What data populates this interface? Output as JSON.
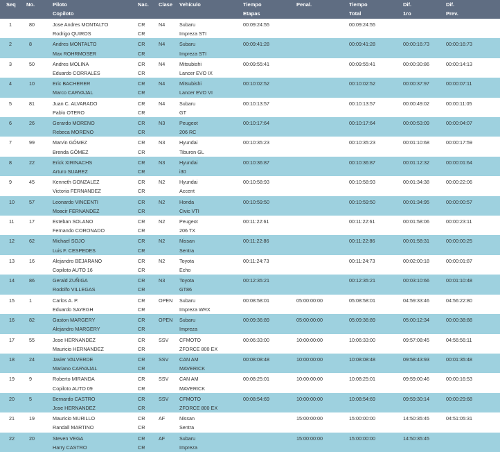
{
  "header": {
    "seq": "Seq",
    "no": "No.",
    "piloto": "Piloto",
    "copiloto": "Copiloto",
    "nac": "Nac.",
    "clase": "Clase",
    "vehiculo": "Vehículo",
    "tiempo_etapas_1": "Tiempo",
    "tiempo_etapas_2": "Etapas",
    "penal": "Penal.",
    "tiempo_total_1": "Tiempo",
    "tiempo_total_2": "Total",
    "dif1ro_1": "Dif.",
    "dif1ro_2": "1ro",
    "difprev_1": "Dif.",
    "difprev_2": "Prev."
  },
  "rows": [
    {
      "seq": "1",
      "no": "80",
      "piloto": "Jose Andres MONTALTO",
      "copiloto": "Rodrigo QUIROS",
      "nac1": "CR",
      "nac2": "CR",
      "clase": "N4",
      "marca": "Subaru",
      "modelo": "Impreza STI",
      "etapas": "00:09:24:55",
      "penal": "",
      "total": "00:09:24:55",
      "dif1ro": "",
      "difprev": ""
    },
    {
      "seq": "2",
      "no": "8",
      "piloto": "Andres MONTALTO",
      "copiloto": "Max ROHRMOSER",
      "nac1": "CR",
      "nac2": "CR",
      "clase": "N4",
      "marca": "Subaru",
      "modelo": "Impreza STI",
      "etapas": "00:09:41:28",
      "penal": "",
      "total": "00:09:41:28",
      "dif1ro": "00:00:16:73",
      "difprev": "00:00:16:73"
    },
    {
      "seq": "3",
      "no": "50",
      "piloto": "Andres MOLINA",
      "copiloto": "Eduardo CORRALES",
      "nac1": "CR",
      "nac2": "CR",
      "clase": "N4",
      "marca": "Mitsubishi",
      "modelo": "Lancer EVO IX",
      "etapas": "00:09:55:41",
      "penal": "",
      "total": "00:09:55:41",
      "dif1ro": "00:00:30:86",
      "difprev": "00:00:14:13"
    },
    {
      "seq": "4",
      "no": "10",
      "piloto": "Eric BACHERER",
      "copiloto": "Marco CARVAJAL",
      "nac1": "CR",
      "nac2": "CR",
      "clase": "N4",
      "marca": "Mitsubishi",
      "modelo": "Lancer EVO VI",
      "etapas": "00:10:02:52",
      "penal": "",
      "total": "00:10:02:52",
      "dif1ro": "00:00:37:97",
      "difprev": "00:00:07:11"
    },
    {
      "seq": "5",
      "no": "81",
      "piloto": "Juan C. ALVARADO",
      "copiloto": "Pablo OTERO",
      "nac1": "CR",
      "nac2": "CR",
      "clase": "N4",
      "marca": "Subaru",
      "modelo": "GT",
      "etapas": "00:10:13:57",
      "penal": "",
      "total": "00:10:13:57",
      "dif1ro": "00:00:49:02",
      "difprev": "00:00:11:05"
    },
    {
      "seq": "6",
      "no": "26",
      "piloto": "Gerardo MORENO",
      "copiloto": "Rebeca MORENO",
      "nac1": "CR",
      "nac2": "CR",
      "clase": "N3",
      "marca": "Peugeot",
      "modelo": "206 RC",
      "etapas": "00:10:17:64",
      "penal": "",
      "total": "00:10:17:64",
      "dif1ro": "00:00:53:09",
      "difprev": "00:00:04:07"
    },
    {
      "seq": "7",
      "no": "99",
      "piloto": "Marvin GÓMEZ",
      "copiloto": "Brenda GÓMEZ",
      "nac1": "CR",
      "nac2": "CR",
      "clase": "N3",
      "marca": "Hyundai",
      "modelo": "Tiburon GL",
      "etapas": "00:10:35:23",
      "penal": "",
      "total": "00:10:35:23",
      "dif1ro": "00:01:10:68",
      "difprev": "00:00:17:59"
    },
    {
      "seq": "8",
      "no": "22",
      "piloto": "Erick XIRINACHS",
      "copiloto": "Arturo SUAREZ",
      "nac1": "CR",
      "nac2": "CR",
      "clase": "N3",
      "marca": "Hyundai",
      "modelo": "i30",
      "etapas": "00:10:36:87",
      "penal": "",
      "total": "00:10:36:87",
      "dif1ro": "00:01:12:32",
      "difprev": "00:00:01:64"
    },
    {
      "seq": "9",
      "no": "45",
      "piloto": "Kenneth GONZALEZ",
      "copiloto": "Victoria FERNANDEZ",
      "nac1": "CR",
      "nac2": "CR",
      "clase": "N2",
      "marca": "Hyundai",
      "modelo": "Accent",
      "etapas": "00:10:58:93",
      "penal": "",
      "total": "00:10:58:93",
      "dif1ro": "00:01:34:38",
      "difprev": "00:00:22:06"
    },
    {
      "seq": "10",
      "no": "57",
      "piloto": "Leonardo VINCENTI",
      "copiloto": "Moacir FERNANDEZ",
      "nac1": "CR",
      "nac2": "CR",
      "clase": "N2",
      "marca": "Honda",
      "modelo": "Civic VTI",
      "etapas": "00:10:59:50",
      "penal": "",
      "total": "00:10:59:50",
      "dif1ro": "00:01:34:95",
      "difprev": "00:00:00:57"
    },
    {
      "seq": "11",
      "no": "17",
      "piloto": "Esteban SOLANO",
      "copiloto": "Fernando CORONADO",
      "nac1": "CR",
      "nac2": "CR",
      "clase": "N2",
      "marca": "Peugeot",
      "modelo": "206 TX",
      "etapas": "00:11:22:61",
      "penal": "",
      "total": "00:11:22:61",
      "dif1ro": "00:01:58:06",
      "difprev": "00:00:23:11"
    },
    {
      "seq": "12",
      "no": "62",
      "piloto": "Michael SOJO",
      "copiloto": "Luis F. CESPEDES",
      "nac1": "CR",
      "nac2": "CR",
      "clase": "N2",
      "marca": "Nissan",
      "modelo": "Sentra",
      "etapas": "00:11:22:86",
      "penal": "",
      "total": "00:11:22:86",
      "dif1ro": "00:01:58:31",
      "difprev": "00:00:00:25"
    },
    {
      "seq": "13",
      "no": "16",
      "piloto": "Alejandro BEJARANO",
      "copiloto": "Copiloto AUTO 16",
      "nac1": "CR",
      "nac2": "CR",
      "clase": "N2",
      "marca": "Toyota",
      "modelo": "Echo",
      "etapas": "00:11:24:73",
      "penal": "",
      "total": "00:11:24:73",
      "dif1ro": "00:02:00:18",
      "difprev": "00:00:01:87"
    },
    {
      "seq": "14",
      "no": "86",
      "piloto": "Gerald ZUÑIGA",
      "copiloto": "Rodolfo VILLEGAS",
      "nac1": "CR",
      "nac2": "CR",
      "clase": "N3",
      "marca": "Toyota",
      "modelo": "GT86",
      "etapas": "00:12:35:21",
      "penal": "",
      "total": "00:12:35:21",
      "dif1ro": "00:03:10:66",
      "difprev": "00:01:10:48"
    },
    {
      "seq": "15",
      "no": "1",
      "piloto": "Carlos A. P.",
      "copiloto": "Eduardo SAYEGH",
      "nac1": "CR",
      "nac2": "CR",
      "clase": "OPEN",
      "marca": "Subaru",
      "modelo": "Impreza WRX",
      "etapas": "00:08:58:01",
      "penal": "05:00:00:00",
      "total": "05:08:58:01",
      "dif1ro": "04:59:33:46",
      "difprev": "04:56:22:80"
    },
    {
      "seq": "16",
      "no": "82",
      "piloto": "Gaston MARGERY",
      "copiloto": "Alejandro MARGERY",
      "nac1": "CR",
      "nac2": "CR",
      "clase": "OPEN",
      "marca": "Subaru",
      "modelo": "Impreza",
      "etapas": "00:09:36:89",
      "penal": "05:00:00:00",
      "total": "05:09:36:89",
      "dif1ro": "05:00:12:34",
      "difprev": "00:00:38:88"
    },
    {
      "seq": "17",
      "no": "55",
      "piloto": "Jose HERNANDEZ",
      "copiloto": "Mauricio HERNANDEZ",
      "nac1": "CR",
      "nac2": "CR",
      "clase": "SSV",
      "marca": "CFMOTO",
      "modelo": "ZFORCE 800 EX",
      "etapas": "00:06:33:00",
      "penal": "10:00:00:00",
      "total": "10:06:33:00",
      "dif1ro": "09:57:08:45",
      "difprev": "04:56:56:11"
    },
    {
      "seq": "18",
      "no": "24",
      "piloto": "Javier VALVERDE",
      "copiloto": "Mariano CARVAJAL",
      "nac1": "CR",
      "nac2": "CR",
      "clase": "SSV",
      "marca": "CAN AM",
      "modelo": "MAVERICK",
      "etapas": "00:08:08:48",
      "penal": "10:00:00:00",
      "total": "10:08:08:48",
      "dif1ro": "09:58:43:93",
      "difprev": "00:01:35:48"
    },
    {
      "seq": "19",
      "no": "9",
      "piloto": "Roberto MIRANDA",
      "copiloto": "Copiloto AUTO 09",
      "nac1": "CR",
      "nac2": "CR",
      "clase": "SSV",
      "marca": "CAN AM",
      "modelo": "MAVERICK",
      "etapas": "00:08:25:01",
      "penal": "10:00:00:00",
      "total": "10:08:25:01",
      "dif1ro": "09:59:00:46",
      "difprev": "00:00:16:53"
    },
    {
      "seq": "20",
      "no": "5",
      "piloto": "Bernardo CASTRO",
      "copiloto": "Jose HERNANDEZ",
      "nac1": "CR",
      "nac2": "CR",
      "clase": "SSV",
      "marca": "CFMOTO",
      "modelo": "ZFORCE 800 EX",
      "etapas": "00:08:54:69",
      "penal": "10:00:00:00",
      "total": "10:08:54:69",
      "dif1ro": "09:59:30:14",
      "difprev": "00:00:29:68"
    },
    {
      "seq": "21",
      "no": "19",
      "piloto": "Mauricio MURILLO",
      "copiloto": "Randall MARTINO",
      "nac1": "CR",
      "nac2": "CR",
      "clase": "AF",
      "marca": "Nissan",
      "modelo": "Sentra",
      "etapas": "",
      "penal": "15:00:00:00",
      "total": "15:00:00:00",
      "dif1ro": "14:50:35:45",
      "difprev": "04:51:05:31"
    },
    {
      "seq": "22",
      "no": "20",
      "piloto": "Steven VEGA",
      "copiloto": "Harry CASTRO",
      "nac1": "CR",
      "nac2": "CR",
      "clase": "AF",
      "marca": "Subaru",
      "modelo": "Impreza",
      "etapas": "",
      "penal": "15:00:00:00",
      "total": "15:00:00:00",
      "dif1ro": "14:50:35:45",
      "difprev": ""
    }
  ]
}
